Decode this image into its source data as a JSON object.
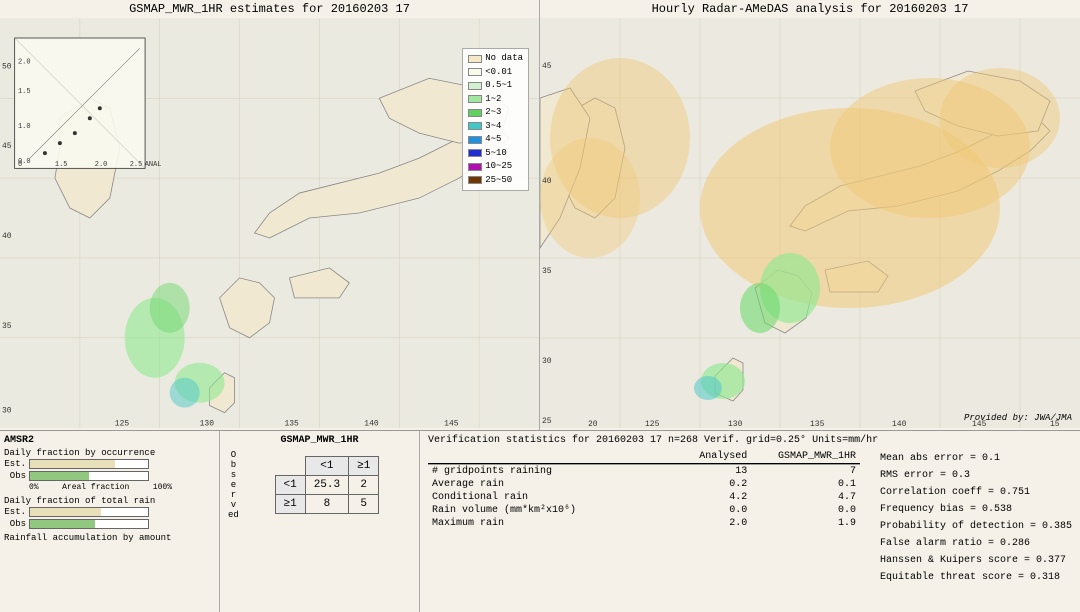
{
  "left_map": {
    "title": "GSMAP_MWR_1HR estimates for 20160203 17"
  },
  "right_map": {
    "title": "Hourly Radar-AMeDAS analysis for 20160203 17",
    "provided_by": "Provided by: JWA/JMA"
  },
  "legend": {
    "items": [
      {
        "label": "No data",
        "color": "#f5e8c8"
      },
      {
        "label": "<0.01",
        "color": "#fff9e0"
      },
      {
        "label": "0.5~1",
        "color": "#e0ffe0"
      },
      {
        "label": "1~2",
        "color": "#b0f0b0"
      },
      {
        "label": "2~3",
        "color": "#80e880"
      },
      {
        "label": "3~4",
        "color": "#40d8d8"
      },
      {
        "label": "4~5",
        "color": "#20a0f0"
      },
      {
        "label": "5~10",
        "color": "#2040e0"
      },
      {
        "label": "10~25",
        "color": "#c020c0"
      },
      {
        "label": "25~50",
        "color": "#804000"
      }
    ]
  },
  "bottom_left": {
    "amsr2_label": "AMSR2",
    "chart1_title": "Daily fraction by occurrence",
    "chart2_title": "Daily fraction of total rain",
    "chart3_title": "Rainfall accumulation by amount",
    "est_label": "Est.",
    "obs_label": "Obs",
    "axis_start": "0%",
    "axis_mid": "Areal fraction",
    "axis_end": "100%"
  },
  "contingency_table": {
    "title": "GSMAP_MWR_1HR",
    "col_labels": [
      "<1",
      "≥1"
    ],
    "row_labels": [
      "<1",
      "≥1"
    ],
    "values": [
      [
        "25.3",
        "2"
      ],
      [
        "8",
        "5"
      ]
    ],
    "observed_label": "O\nb\ns\ne\nr\nv\ne\nd"
  },
  "verification": {
    "title": "Verification statistics for 20160203 17  n=268  Verif. grid=0.25°  Units=mm/hr",
    "col_headers": [
      "Analysed",
      "GSMAP_MWR_1HR"
    ],
    "rows": [
      {
        "label": "# gridpoints raining",
        "val1": "13",
        "val2": "7"
      },
      {
        "label": "Average rain",
        "val1": "0.2",
        "val2": "0.1"
      },
      {
        "label": "Conditional rain",
        "val1": "4.2",
        "val2": "4.7"
      },
      {
        "label": "Rain volume (mm*km²x10⁶)",
        "val1": "0.0",
        "val2": "0.0"
      },
      {
        "label": "Maximum rain",
        "val1": "2.0",
        "val2": "1.9"
      }
    ],
    "right_stats": [
      "Mean abs error = 0.1",
      "RMS error = 0.3",
      "Correlation coeff = 0.751",
      "Frequency bias = 0.538",
      "Probability of detection = 0.385",
      "False alarm ratio = 0.286",
      "Hanssen & Kuipers score = 0.377",
      "Equitable threat score = 0.318"
    ]
  }
}
